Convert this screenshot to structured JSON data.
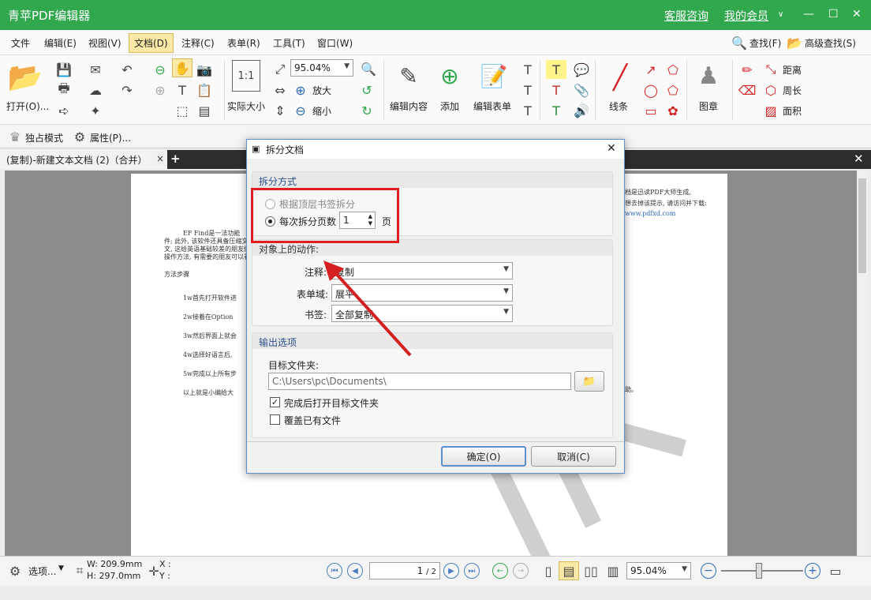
{
  "titlebar": {
    "title": "青苹PDF编辑器",
    "support": "客服咨询",
    "member": "我的会员"
  },
  "menu": {
    "items": [
      "文件",
      "编辑(E)",
      "视图(V)",
      "文档(D)",
      "注释(C)",
      "表单(R)",
      "工具(T)",
      "窗口(W)"
    ],
    "active_index": 3,
    "find": "查找(F)",
    "advanced_find": "高级查找(S)"
  },
  "toolbar": {
    "open": "打开(O)...",
    "actual_size": "实际大小",
    "zoom_value": "95.04%",
    "zoom_in": "放大",
    "zoom_out": "缩小",
    "edit_content": "编辑内容",
    "add": "添加",
    "edit_form": "编辑表单",
    "lines": "线条",
    "stamp": "图章",
    "distance": "距离",
    "perimeter": "周长",
    "area": "面积"
  },
  "subbar": {
    "exclusive": "独占模式",
    "properties": "属性(P)..."
  },
  "tab": {
    "label": "(复制)-新建文本文档 (2)（合并）",
    "close": "×",
    "add": "+"
  },
  "document": {
    "lines": [
      "EF Find是一法功能",
      "件; 此外, 该软件还具备压缩文",
      "文, 这给英语基础较差的朋友们",
      "操作方法, 有需要的朋友可以看",
      "方法步骤",
      "1w首先打开软件进",
      "2w接着在Option",
      "3w然后界面上就会",
      "4w选择好语言后,",
      "5w完成以上所有步",
      "以上就是小编给大"
    ],
    "right_notes": [
      "档是迅读PDF大师生成,",
      "想去掉该提示, 请访问并下载:",
      "www.pdfxd.com"
    ],
    "tail": "助。"
  },
  "dialog": {
    "title": "拆分文档",
    "split_group": "拆分方式",
    "by_bookmark": "根据顶层书签拆分",
    "by_pages": "每次拆分页数",
    "pages_value": "1",
    "pages_unit": "页",
    "actions_group": "对象上的动作:",
    "annotation_label": "注释:",
    "annotation_value": "复制",
    "form_label": "表单域:",
    "form_value": "展平",
    "bookmark_label": "书签:",
    "bookmark_value": "全部复制",
    "output_group": "输出选项",
    "target_label": "目标文件夹:",
    "target_value": "C:\\Users\\pc\\Documents\\",
    "open_after": "完成后打开目标文件夹",
    "open_after_checked": true,
    "overwrite": "覆盖已有文件",
    "overwrite_checked": false,
    "ok": "确定(O)",
    "cancel": "取消(C)"
  },
  "status": {
    "options": "选项...",
    "width": "W: 209.9mm",
    "height": "H: 297.0mm",
    "x": "X :",
    "y": "Y :",
    "page_current": "1",
    "page_total": "/ 2",
    "zoom": "95.04%"
  },
  "colors": {
    "titlebar": "#31a84d",
    "highlight": "#e02020",
    "arrow": "#d42020"
  }
}
